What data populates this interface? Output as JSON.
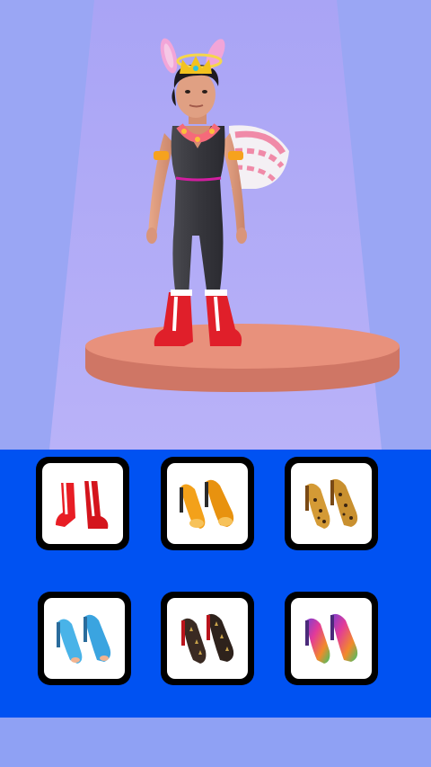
{
  "colors": {
    "background": "#9aa6f4",
    "spotlight": "#b3acf7",
    "panel": "#0052f2",
    "pedestal": "#e8917c"
  },
  "character": {
    "accessories": [
      "bunny-ears",
      "crown",
      "halo",
      "flower-necklace",
      "wings",
      "gold-armbands",
      "red-boots"
    ],
    "outfit": "black-jumpsuit"
  },
  "shoe_options": [
    {
      "id": "red-boots",
      "color": "#e81d24"
    },
    {
      "id": "orange-pumps",
      "color": "#f3a11a"
    },
    {
      "id": "leopard-pumps",
      "color": "#c9902f"
    },
    {
      "id": "blue-peeptoe",
      "color": "#49b3e8"
    },
    {
      "id": "spiked-pumps",
      "color": "#3a2a22"
    },
    {
      "id": "rainbow-pumps",
      "color": "#8a3fc9"
    }
  ]
}
